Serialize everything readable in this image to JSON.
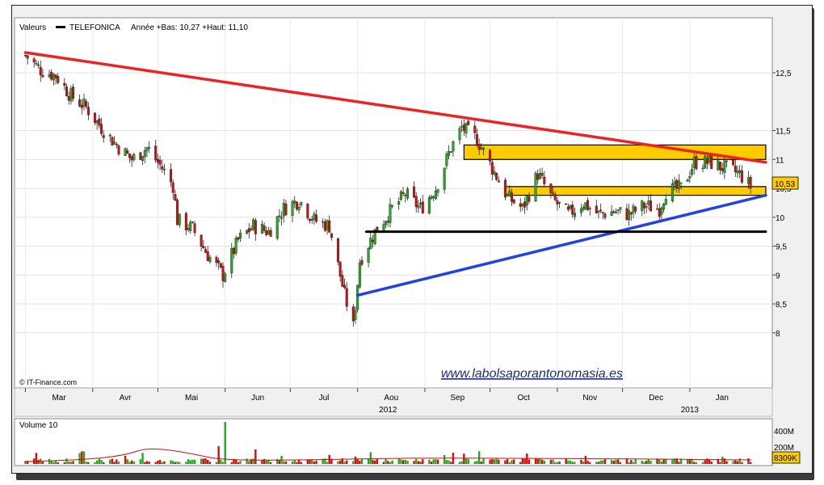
{
  "header": {
    "legend_label": "Valeurs",
    "symbol": "TELEFONICA",
    "range_text": "Année +Bas: 10,27 +Haut: 11,10"
  },
  "source_label": "© IT-Finance.com",
  "watermark": "www.labolsaporantonomasia.es",
  "current_price_label": "10,53",
  "volume_panel": {
    "title": "Volume 10",
    "axis_labels": [
      "400M",
      "200M"
    ],
    "current_volume_label": "8309K"
  },
  "colors": {
    "up": "#22aa22",
    "down": "#cc1111",
    "trend_down": "#ee2222",
    "trend_up": "#2244dd",
    "support": "#000000",
    "zone_fill": "#ffcc00",
    "price_marker": "#ffcc00",
    "watermark": "#1a2a8a"
  },
  "chart_data": {
    "type": "candlestick",
    "title": "TELEFONICA",
    "y_ticks": [
      "12,5",
      "11,5",
      "11",
      "10,5",
      "10",
      "9,5",
      "9",
      "8,5",
      "8"
    ],
    "y_tick_values": [
      12.5,
      11.5,
      11,
      10.5,
      10,
      9.5,
      9,
      8.5,
      8
    ],
    "ylim": [
      7.6,
      13.0
    ],
    "x_month_labels": [
      "Mar",
      "Avr",
      "Mai",
      "Jun",
      "Jul",
      "Aou",
      "Sep",
      "Oct",
      "Nov",
      "Dec",
      "Jan"
    ],
    "x_year_labels": [
      "2012",
      "2013"
    ],
    "price_path": [
      {
        "d": "2012-03-01",
        "v": 12.8
      },
      {
        "d": "2012-03-08",
        "v": 12.55
      },
      {
        "d": "2012-03-15",
        "v": 12.45
      },
      {
        "d": "2012-03-22",
        "v": 12.1
      },
      {
        "d": "2012-03-29",
        "v": 11.9
      },
      {
        "d": "2012-04-05",
        "v": 11.55
      },
      {
        "d": "2012-04-12",
        "v": 11.25
      },
      {
        "d": "2012-04-19",
        "v": 11.0
      },
      {
        "d": "2012-04-26",
        "v": 11.2
      },
      {
        "d": "2012-05-03",
        "v": 10.85
      },
      {
        "d": "2012-05-08",
        "v": 10.55
      },
      {
        "d": "2012-05-10",
        "v": 9.95
      },
      {
        "d": "2012-05-17",
        "v": 9.8
      },
      {
        "d": "2012-05-24",
        "v": 9.35
      },
      {
        "d": "2012-05-31",
        "v": 9.0
      },
      {
        "d": "2012-06-07",
        "v": 9.6
      },
      {
        "d": "2012-06-14",
        "v": 9.85
      },
      {
        "d": "2012-06-21",
        "v": 9.75
      },
      {
        "d": "2012-06-28",
        "v": 10.15
      },
      {
        "d": "2012-07-05",
        "v": 10.3
      },
      {
        "d": "2012-07-12",
        "v": 9.95
      },
      {
        "d": "2012-07-19",
        "v": 9.85
      },
      {
        "d": "2012-07-26",
        "v": 8.65
      },
      {
        "d": "2012-07-30",
        "v": 8.1
      },
      {
        "d": "2012-08-02",
        "v": 9.25
      },
      {
        "d": "2012-08-09",
        "v": 9.75
      },
      {
        "d": "2012-08-16",
        "v": 10.1
      },
      {
        "d": "2012-08-23",
        "v": 10.4
      },
      {
        "d": "2012-08-30",
        "v": 10.15
      },
      {
        "d": "2012-09-06",
        "v": 10.5
      },
      {
        "d": "2012-09-13",
        "v": 11.2
      },
      {
        "d": "2012-09-18",
        "v": 11.55
      },
      {
        "d": "2012-09-25",
        "v": 11.35
      },
      {
        "d": "2012-10-02",
        "v": 10.85
      },
      {
        "d": "2012-10-09",
        "v": 10.35
      },
      {
        "d": "2012-10-16",
        "v": 10.15
      },
      {
        "d": "2012-10-23",
        "v": 10.75
      },
      {
        "d": "2012-10-30",
        "v": 10.3
      },
      {
        "d": "2012-11-06",
        "v": 10.05
      },
      {
        "d": "2012-11-13",
        "v": 10.25
      },
      {
        "d": "2012-11-20",
        "v": 10.05
      },
      {
        "d": "2012-11-27",
        "v": 10.1
      },
      {
        "d": "2012-12-04",
        "v": 10.05
      },
      {
        "d": "2012-12-11",
        "v": 10.2
      },
      {
        "d": "2012-12-18",
        "v": 10.15
      },
      {
        "d": "2012-12-21",
        "v": 10.45
      },
      {
        "d": "2012-12-28",
        "v": 10.5
      },
      {
        "d": "2013-01-03",
        "v": 10.95
      },
      {
        "d": "2013-01-10",
        "v": 10.95
      },
      {
        "d": "2013-01-17",
        "v": 10.85
      },
      {
        "d": "2013-01-24",
        "v": 10.75
      },
      {
        "d": "2013-01-29",
        "v": 10.53
      }
    ],
    "trend_lines": [
      {
        "name": "resistance",
        "from": {
          "d": "2012-03-01",
          "v": 12.85
        },
        "to": {
          "d": "2013-02-05",
          "v": 10.95
        }
      },
      {
        "name": "support",
        "from": {
          "d": "2012-08-01",
          "v": 8.65
        },
        "to": {
          "d": "2013-02-05",
          "v": 10.38
        }
      },
      {
        "name": "horizontal",
        "from": {
          "d": "2012-08-05",
          "v": 9.75
        },
        "to": {
          "d": "2013-02-05",
          "v": 9.75
        }
      }
    ],
    "zones": [
      {
        "from_d": "2012-09-19",
        "to_d": "2013-02-05",
        "low": 11.0,
        "high": 11.25
      },
      {
        "from_d": "2012-10-08",
        "to_d": "2013-02-05",
        "low": 10.38,
        "high": 10.53
      }
    ],
    "volume_levels": [
      400,
      200
    ],
    "volume_unit": "M"
  }
}
